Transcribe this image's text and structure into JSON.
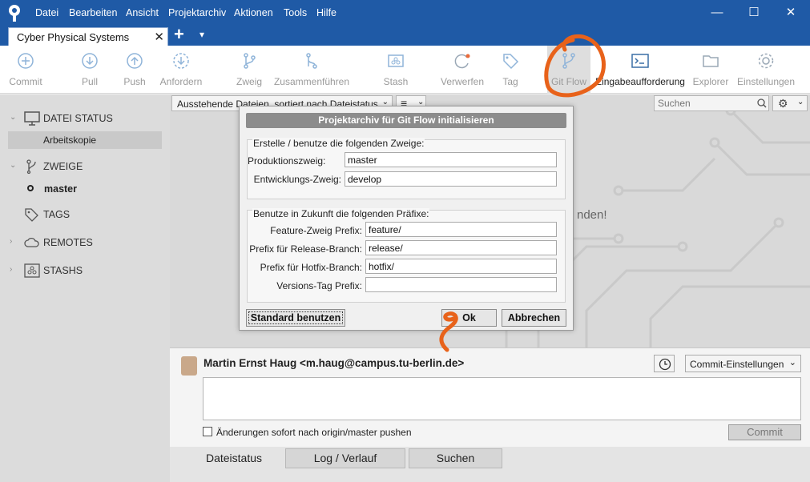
{
  "menu": [
    "Datei",
    "Bearbeiten",
    "Ansicht",
    "Projektarchiv",
    "Aktionen",
    "Tools",
    "Hilfe"
  ],
  "window_controls": {
    "minimize": "—",
    "maximize": "☐",
    "close": "✕"
  },
  "tab": {
    "title": "Cyber Physical Systems",
    "close": "✕",
    "add": "+",
    "dropdown": "▾"
  },
  "toolbar": {
    "commit": "Commit",
    "pull": "Pull",
    "push": "Push",
    "fetch": "Anfordern",
    "branch": "Zweig",
    "merge": "Zusammenführen",
    "stash": "Stash",
    "discard": "Verwerfen",
    "tag": "Tag",
    "gitflow": "Git Flow",
    "terminal": "Eingabeaufforderung",
    "explorer": "Explorer",
    "settings": "Einstellungen"
  },
  "filter": {
    "sort_label": "Ausstehende Dateien, sortiert nach Dateistatus",
    "search_placeholder": "Suchen"
  },
  "sidebar": {
    "file_status": "DATEI STATUS",
    "working_copy": "Arbeitskopie",
    "branches": "ZWEIGE",
    "current_branch": "master",
    "tags": "TAGS",
    "remotes": "REMOTES",
    "stashes": "STASHS"
  },
  "main": {
    "empty_hint": "nden!"
  },
  "dialog": {
    "title": "Projektarchiv für Git Flow initialisieren",
    "group1_title": "Erstelle / benutze die folgenden Zweige:",
    "production_label": "Produktionszweig:",
    "production_value": "master",
    "develop_label": "Entwicklungs-Zweig:",
    "develop_value": "develop",
    "group2_title": "Benutze in Zukunft die folgenden Präfixe:",
    "feature_label": "Feature-Zweig Prefix:",
    "feature_value": "feature/",
    "release_label": "Prefix für Release-Branch:",
    "release_value": "release/",
    "hotfix_label": "Prefix für Hotfix-Branch:",
    "hotfix_value": "hotfix/",
    "versiontag_label": "Versions-Tag Prefix:",
    "versiontag_value": "",
    "defaults_button": "Standard benutzen",
    "ok_button": "Ok",
    "cancel_button": "Abbrechen"
  },
  "commit": {
    "author": "Martin Ernst Haug <m.haug@campus.tu-berlin.de>",
    "options_label": "Commit-Einstellungen",
    "push_checkbox_label": "Änderungen sofort nach origin/master pushen",
    "commit_button": "Commit"
  },
  "bottom_tabs": [
    "Dateistatus",
    "Log / Verlauf",
    "Suchen"
  ],
  "colors": {
    "titlebar": "#1f5aa6",
    "annotation": "#e8621a",
    "toolbar_icon": "#8fb4d9"
  }
}
